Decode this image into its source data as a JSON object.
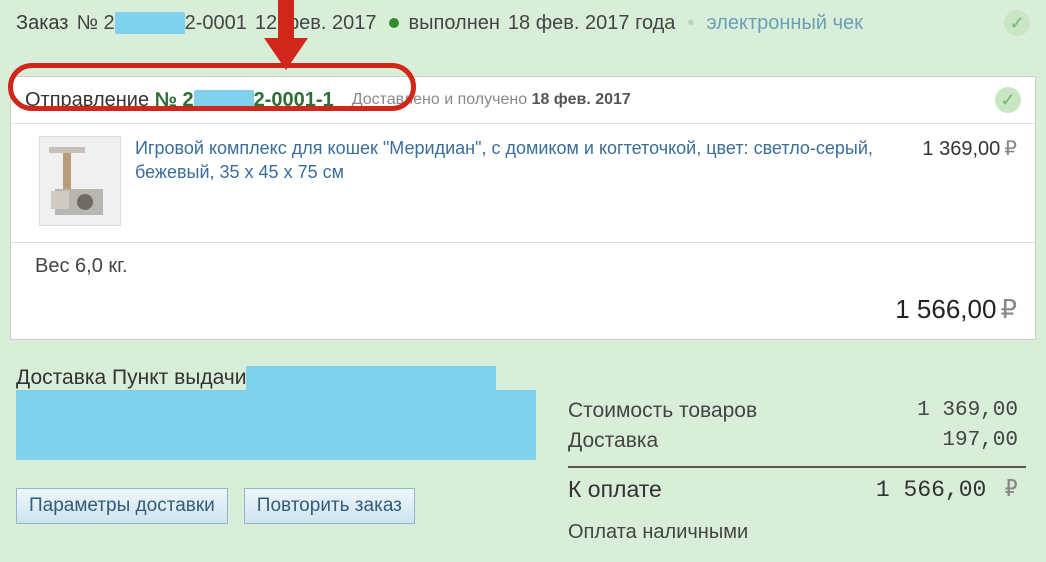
{
  "order": {
    "label": "Заказ",
    "num_prefix": "№ 2",
    "num_suffix": "2-0001",
    "date": "12 фев. 2017",
    "status": "выполнен",
    "completed_date": "18 фев. 2017 года",
    "e_receipt": "электронный чек"
  },
  "shipment": {
    "label": "Отправление",
    "num_prefix": "№ 2",
    "num_suffix": "2-0001-1",
    "status_text": "Доставлено и получено",
    "status_date": "18 фев. 2017"
  },
  "product": {
    "name": "Игровой комплекс для кошек \"Меридиан\", с домиком и когтеточкой, цвет: светло-серый, бежевый, 35 x 45 x 75 см",
    "price": "1 369,00",
    "currency": "₽"
  },
  "weight_line": "Вес 6,0 кг.",
  "shipment_total": "1 566,00",
  "delivery": {
    "label": "Доставка Пункт выдачи"
  },
  "buttons": {
    "params": "Параметры доставки",
    "repeat": "Повторить заказ"
  },
  "summary": {
    "goods_label": "Стоимость товаров",
    "goods_value": "1 369,00",
    "delivery_label": "Доставка",
    "delivery_value": "197,00",
    "total_label": "К оплате",
    "total_value": "1 566,00",
    "currency": "₽",
    "payment_method": "Оплата наличными"
  }
}
